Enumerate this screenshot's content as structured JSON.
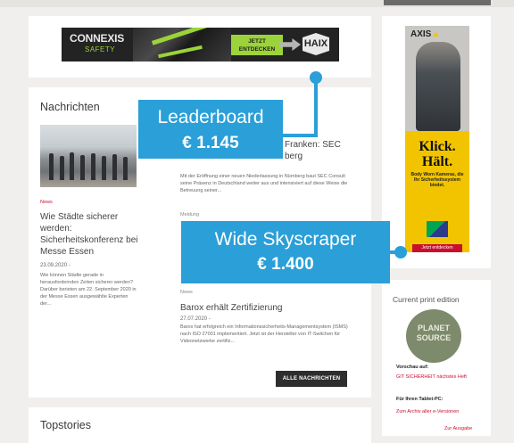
{
  "leaderboard_ad": {
    "brand": "CONNEXIS",
    "brand_accent": "X",
    "sub": "SAFETY",
    "cta": "JETZT ENTDECKEN",
    "logo": "HAIX"
  },
  "news": {
    "title": "Nachrichten",
    "items": [
      {
        "tag": "News",
        "title": "Wie Städte sicherer werden: Sicherheitskonferenz bei Messe Essen",
        "date": "23.09.2020 -",
        "text": "Wie können Städte gerade in herausfordernden Zeiten sicherer werden? Darüber berieten am 22. September 2020 in der Messe Essen ausgewählte Experten der..."
      },
      {
        "tag": "",
        "title": "Franken: SEC berg",
        "date": "",
        "text": "Mit der Eröffnung einer neuen Niederlassung in Nürnberg baut SEC Consult seine Präsenz in Deutschland weiter aus und intensiviert auf diese Weise die Betreuung seiner..."
      },
      {
        "tag": "Meldung",
        "title": "",
        "date": "",
        "text": ""
      },
      {
        "tag": "News",
        "title": "Barox erhält Zertifizierung",
        "date": "27.07.2020 -",
        "text": "Barox hat erfolgreich ein Informationssicherheits-Managementsystem (ISMS) nach ISO 27001 implementiert. Jetzt ist der Hersteller von IT-Switchen für Videonetzwerke zertifiz..."
      }
    ],
    "all_button": "ALLE NACHRICHTEN"
  },
  "topstories": {
    "title": "Topstories"
  },
  "skyscraper_ad": {
    "logo": "AXIS",
    "headline_1": "Klick.",
    "headline_2": "Hält.",
    "small_text": "Body Worn Kameras, die Ihr Sicherheitssystem bindet.",
    "button": "Jetzt entdecken"
  },
  "print": {
    "title": "Current print edition",
    "cover_title_1": "PLANET",
    "cover_title_2": "SOURCE",
    "preview_label": "Vorschau auf:",
    "preview_link": "GIT SICHERHEIT nächstes Heft",
    "tablet_label": "Für Ihren Tablet-PC:",
    "archive_link": "Zum Archiv aller e-Versionen",
    "issue_link": "Zur Ausgabe"
  },
  "overlays": {
    "leaderboard": {
      "label": "Leaderboard",
      "price": "€ 1.145"
    },
    "skyscraper": {
      "label": "Wide Skyscraper",
      "price": "€ 1.400"
    },
    "accent_color": "#2a9fd8"
  }
}
